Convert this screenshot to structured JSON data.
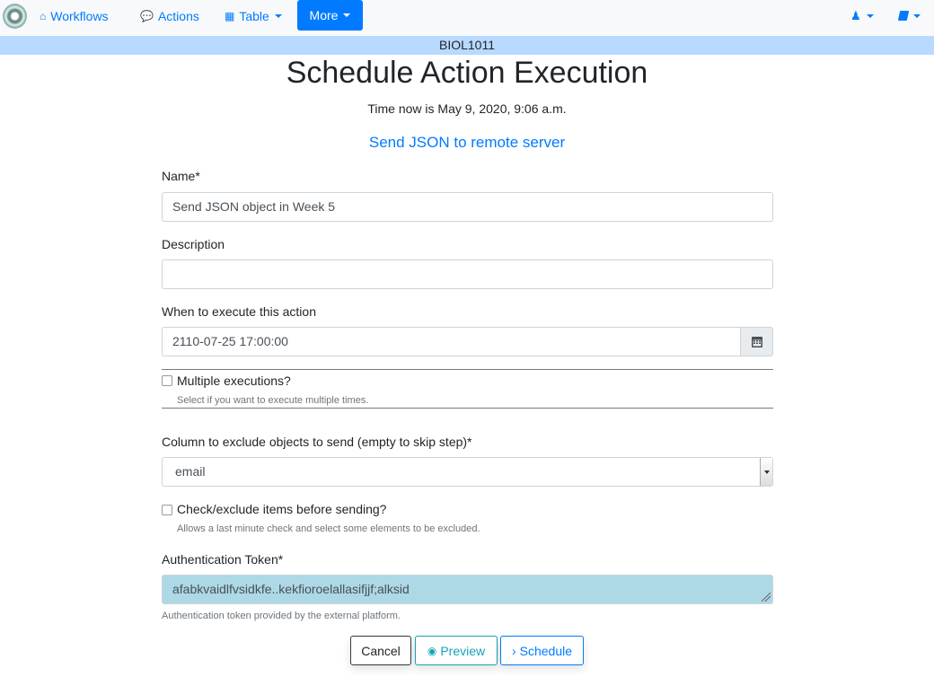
{
  "navbar": {
    "items": [
      {
        "label": "Workflows",
        "icon": "home-icon"
      },
      {
        "label": "Actions",
        "icon": "comments-icon"
      },
      {
        "label": "Table",
        "icon": "table-icon"
      },
      {
        "label": "More"
      }
    ],
    "right_icons": [
      "user-icon",
      "book-icon"
    ]
  },
  "banner": "BIOL1011",
  "page": {
    "title": "Schedule Action Execution",
    "time_now": "Time now is May 9, 2020, 9:06 a.m.",
    "action_link": "Send JSON to remote server"
  },
  "form": {
    "name_label": "Name*",
    "name_value": "Send JSON object in Week 5",
    "description_label": "Description",
    "description_value": "",
    "when_label": "When to execute this action",
    "when_value": "2110-07-25 17:00:00",
    "multiple_label": "Multiple executions?",
    "multiple_help": "Select if you want to execute multiple times.",
    "multiple_checked": false,
    "exclude_column_label": "Column to exclude objects to send (empty to skip step)*",
    "exclude_column_value": "email",
    "confirm_label": "Check/exclude items before sending?",
    "confirm_help": "Allows a last minute check and select some elements to be excluded.",
    "confirm_checked": false,
    "token_label": "Authentication Token*",
    "token_value": "afabkvaidlfvsidkfe..kekfioroelallasifjjf;alksid",
    "token_help": "Authentication token provided by the external platform."
  },
  "buttons": {
    "cancel": "Cancel",
    "preview": "Preview",
    "schedule": "Schedule"
  },
  "colors": {
    "primary": "#007bff",
    "info": "#17a2b8",
    "banner": "#b8daff",
    "token_bg": "#add8e6"
  }
}
